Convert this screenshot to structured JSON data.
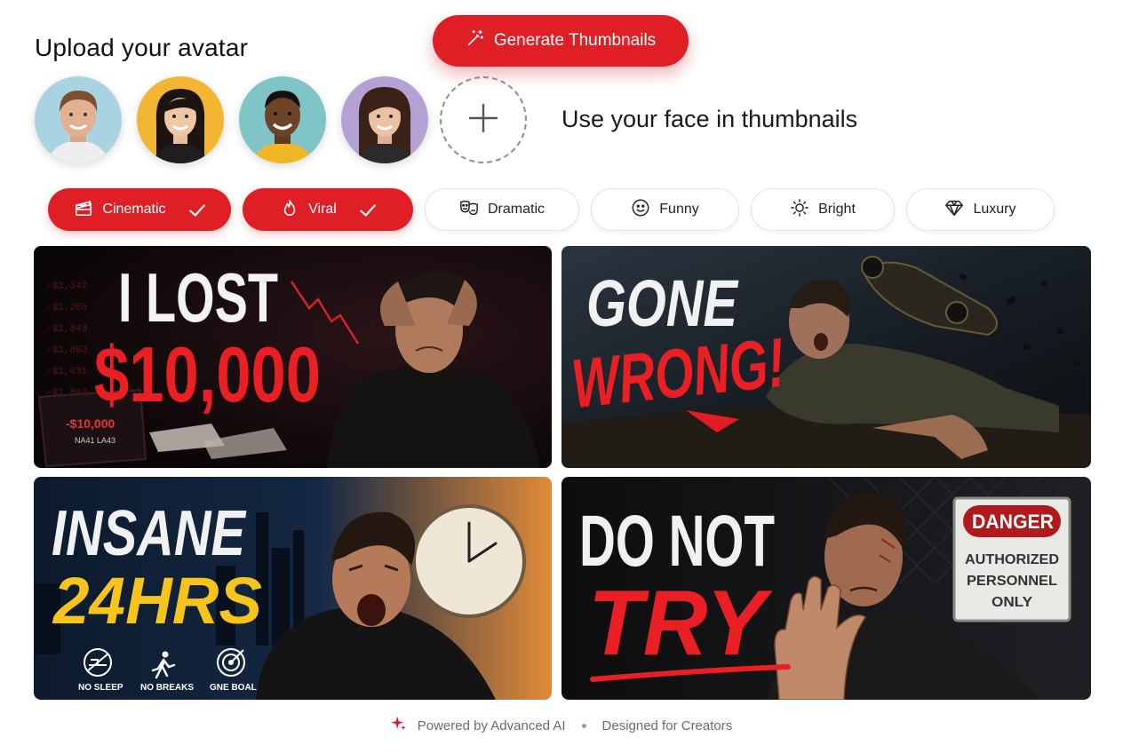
{
  "header": {
    "title": "Upload your avatar",
    "generate_label": "Generate Thumbnails"
  },
  "avatars": {
    "items": [
      {
        "name": "avatar-1",
        "bg": "#a9d3e2"
      },
      {
        "name": "avatar-2",
        "bg": "#f2b632"
      },
      {
        "name": "avatar-3",
        "bg": "#7fc4c6"
      },
      {
        "name": "avatar-4",
        "bg": "#b5a2d4"
      }
    ],
    "add_icon": "plus-icon",
    "tagline": "Use your face in thumbnails"
  },
  "styles": [
    {
      "label": "Cinematic",
      "icon": "clapperboard-icon",
      "selected": true
    },
    {
      "label": "Viral",
      "icon": "flame-icon",
      "selected": true
    },
    {
      "label": "Dramatic",
      "icon": "theater-masks-icon",
      "selected": false
    },
    {
      "label": "Funny",
      "icon": "smiley-icon",
      "selected": false
    },
    {
      "label": "Bright",
      "icon": "sun-icon",
      "selected": false
    },
    {
      "label": "Luxury",
      "icon": "diamond-icon",
      "selected": false
    }
  ],
  "thumbnails": [
    {
      "line1": "I LOST",
      "line2": "$10,000",
      "screen_text": "-$10,000",
      "screen_sub": "NA41 LA43",
      "ticker": [
        "-$1,342",
        "-$1,265",
        "-$1,843",
        "-$1,863",
        "-$1,631",
        "-$1,842"
      ]
    },
    {
      "line1": "GONE",
      "line2": "WRONG!"
    },
    {
      "line1": "INSANE",
      "line2": "24HRS",
      "badges": [
        "NO SLEEP",
        "NO BREAKS",
        "GNE BOAL"
      ]
    },
    {
      "line1": "DO NOT",
      "line2": "TRY",
      "sign_title": "DANGER",
      "sign_lines": [
        "AUTHORIZED",
        "PERSONNEL",
        "ONLY"
      ]
    }
  ],
  "footer": {
    "left": "Powered by Advanced AI",
    "right": "Designed for Creators"
  },
  "colors": {
    "accent": "#e01e26",
    "text": "#1d1d1f",
    "muted": "#6b6b6b"
  }
}
